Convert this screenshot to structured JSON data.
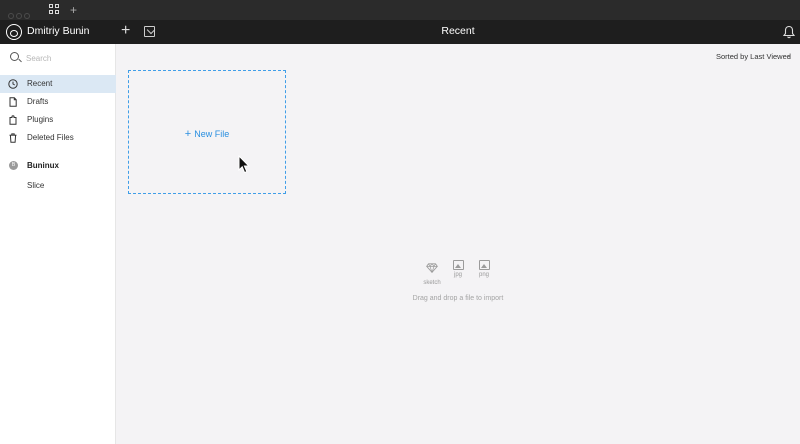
{
  "app": {
    "user_name": "Dmitriy Bunin",
    "page_title": "Recent"
  },
  "sidebar": {
    "search_placeholder": "Search",
    "items": [
      {
        "label": "Recent",
        "icon": "clock-icon",
        "active": true
      },
      {
        "label": "Drafts",
        "icon": "document-icon",
        "active": false
      },
      {
        "label": "Plugins",
        "icon": "plugin-icon",
        "active": false
      },
      {
        "label": "Deleted Files",
        "icon": "trash-icon",
        "active": false
      }
    ],
    "team": {
      "badge": "B",
      "name": "Buninux"
    },
    "projects": [
      "Slice"
    ]
  },
  "main": {
    "sort_label": "Sorted by Last Viewed",
    "new_file_label": "New File",
    "file_types": [
      "sketch",
      "jpg",
      "png"
    ],
    "drop_hint": "Drag and drop a file to import"
  },
  "colors": {
    "accent": "#2a8fe0",
    "toolbar_bg": "#1e1e1e",
    "sidebar_active": "#dbe8f4",
    "page_bg": "#f4f3f5"
  }
}
